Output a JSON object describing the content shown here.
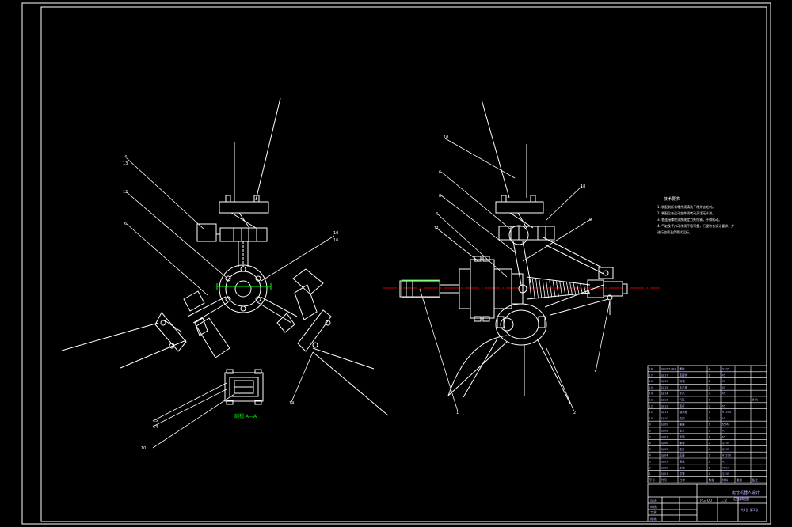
{
  "drawing": {
    "background_color": "#000000",
    "frame_color": "#ffffff",
    "center_line_color": "#ff0000",
    "annotation_color": "#00ff00",
    "title_block_text_color": "#c9b1ff"
  },
  "left_view": {
    "callouts": [
      "4",
      "13",
      "12",
      "6",
      "10",
      "16",
      "14",
      "15",
      "14"
    ],
    "section_label": "剖视 A—A"
  },
  "right_view": {
    "callouts": [
      "10",
      "6",
      "8",
      "4",
      "11",
      "18",
      "9",
      "2",
      "3",
      "1"
    ]
  },
  "notes": {
    "title": "技术要求",
    "lines": [
      "1. 装配前所有零件须清洗干净并去毛刺。",
      "2. 装配后各运动部件须转动灵活无卡滞。",
      "3. 各连接螺栓须按规定力矩拧紧，不得松动。",
      "4. 气缸及手爪动作须平稳可靠，行程符合设计要求，并",
      "进行空载及负载试运行。"
    ]
  },
  "bom": {
    "headers": [
      "序号",
      "代号",
      "名称",
      "数量",
      "材料",
      "重量",
      "备注"
    ],
    "rows": [
      [
        "18",
        "GB/T 5783",
        "螺栓",
        "4",
        "Q235",
        "",
        ""
      ],
      [
        "17",
        "SJ-17",
        "连接件",
        "1",
        "45",
        "",
        ""
      ],
      [
        "16",
        "SJ-16",
        "销轴",
        "2",
        "45",
        "",
        ""
      ],
      [
        "15",
        "SJ-15",
        "手爪座",
        "1",
        "45",
        "",
        ""
      ],
      [
        "14",
        "SJ-14",
        "手爪",
        "3",
        "45",
        "",
        ""
      ],
      [
        "13",
        "SJ-13",
        "气缸",
        "1",
        "",
        "",
        "外购"
      ],
      [
        "12",
        "SJ-12",
        "连杆",
        "3",
        "45",
        "",
        ""
      ],
      [
        "11",
        "SJ-11",
        "轴承座",
        "1",
        "HT200",
        "",
        ""
      ],
      [
        "10",
        "SJ-10",
        "支架",
        "1",
        "45",
        "",
        ""
      ],
      [
        "9",
        "SJ-09",
        "弹簧",
        "1",
        "65Mn",
        "",
        ""
      ],
      [
        "8",
        "SJ-08",
        "法兰",
        "1",
        "45",
        "",
        ""
      ],
      [
        "7",
        "SJ-07",
        "套筒",
        "1",
        "45",
        "",
        ""
      ],
      [
        "6",
        "SJ-06",
        "螺母",
        "2",
        "Q235",
        "",
        ""
      ],
      [
        "5",
        "SJ-05",
        "垫片",
        "4",
        "Q235",
        "",
        ""
      ],
      [
        "4",
        "SJ-04",
        "底座",
        "1",
        "HT200",
        "",
        ""
      ],
      [
        "3",
        "SJ-03",
        "滚轮",
        "2",
        "45",
        "",
        ""
      ],
      [
        "2",
        "SJ-02",
        "主轴",
        "1",
        "40Cr",
        "",
        ""
      ],
      [
        "1",
        "SJ-01",
        "导管",
        "1",
        "Q235",
        "",
        ""
      ]
    ]
  },
  "title_block": {
    "title_line_1": "爬管机器人设计",
    "title_line_2": "总装配图",
    "drawing_no": "PG-00",
    "scale": "1:2",
    "sheet": "共1张 第1张",
    "role_rows": [
      "设计",
      "审核",
      "工艺",
      "批准"
    ]
  }
}
